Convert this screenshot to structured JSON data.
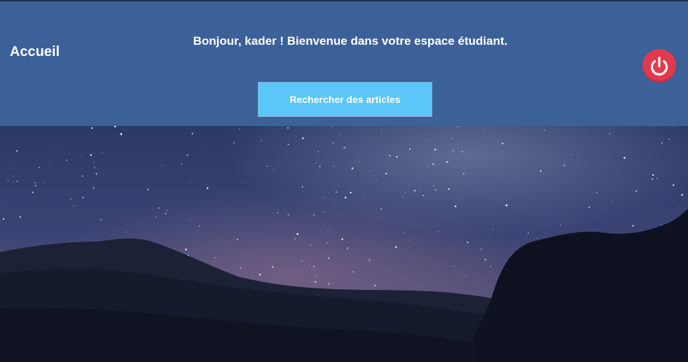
{
  "header": {
    "page_title": "Accueil",
    "welcome_message": "Bonjour, kader ! Bienvenue dans votre espace étudiant.",
    "search_button_label": "Rechercher des articles",
    "logout_icon": "power-icon"
  },
  "colors": {
    "header_background": "#3c6199",
    "search_button": "#5bc6f8",
    "logout_button": "#e2394f"
  }
}
